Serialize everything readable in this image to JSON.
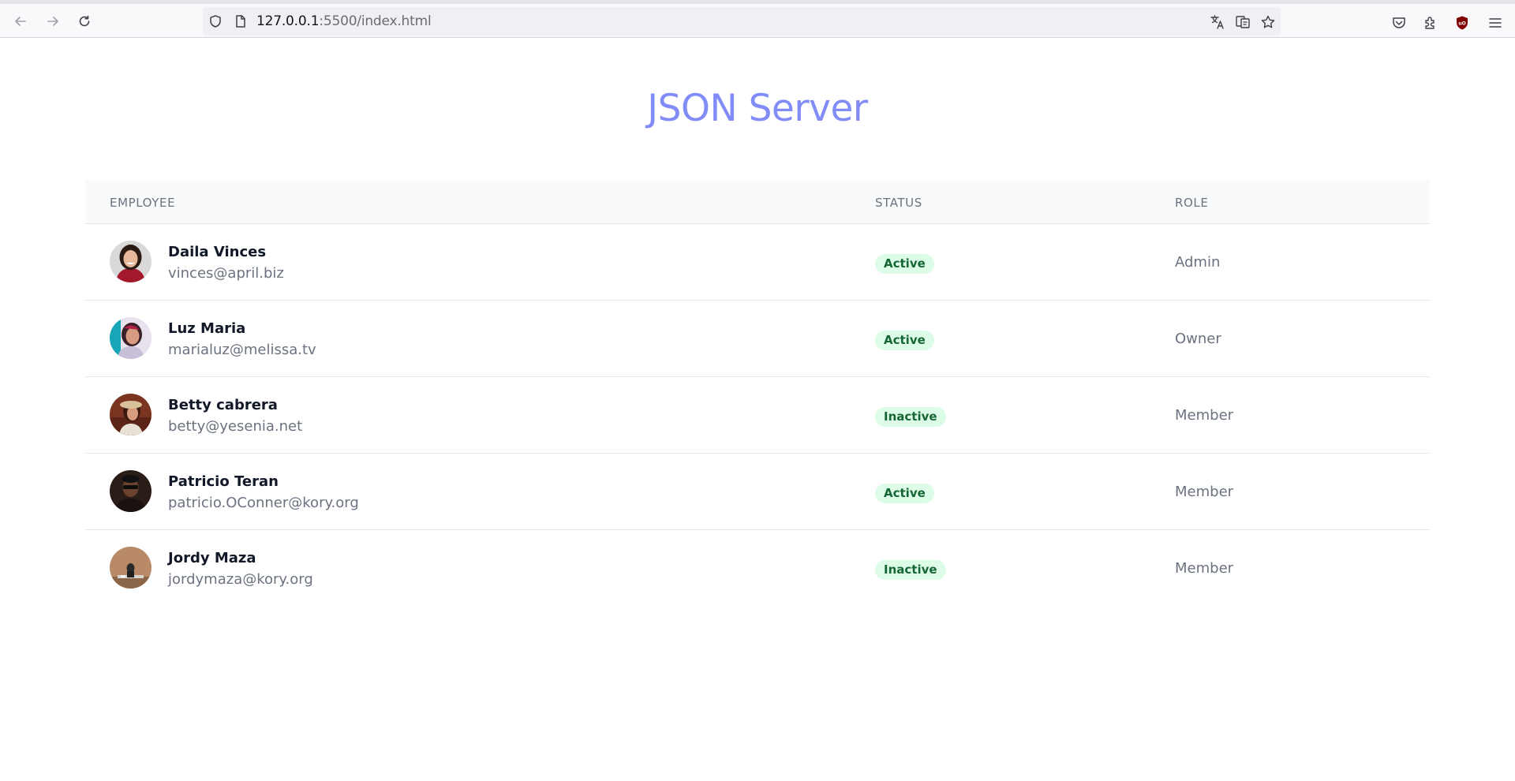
{
  "browser": {
    "url_host": "127.0.0.1",
    "url_rest": ":5500/index.html",
    "icons": [
      "back-arrow-icon",
      "forward-arrow-icon",
      "reload-icon",
      "shield-icon",
      "page-icon",
      "translate-icon",
      "reader-icon",
      "bookmark-star-icon",
      "pocket-icon",
      "extensions-icon",
      "ublock-icon",
      "menu-icon"
    ]
  },
  "page": {
    "title": "JSON Server"
  },
  "table": {
    "headers": {
      "employee": "EMPLOYEE",
      "status": "STATUS",
      "role": "ROLE"
    },
    "rows": [
      {
        "name": "Daila Vinces",
        "email": "vinces@april.biz",
        "status": "Active",
        "role": "Admin"
      },
      {
        "name": "Luz Maria",
        "email": "marialuz@melissa.tv",
        "status": "Active",
        "role": "Owner"
      },
      {
        "name": "Betty cabrera",
        "email": "betty@yesenia.net",
        "status": "Inactive",
        "role": "Member"
      },
      {
        "name": "Patricio Teran",
        "email": "patricio.OConner@kory.org",
        "status": "Active",
        "role": "Member"
      },
      {
        "name": "Jordy Maza",
        "email": "jordymaza@kory.org",
        "status": "Inactive",
        "role": "Member"
      }
    ]
  },
  "colors": {
    "title": "#818cf8",
    "badge_bg": "#dcfce7",
    "badge_text": "#166534",
    "header_bg": "#f9fafb",
    "muted_text": "#6b7280"
  }
}
